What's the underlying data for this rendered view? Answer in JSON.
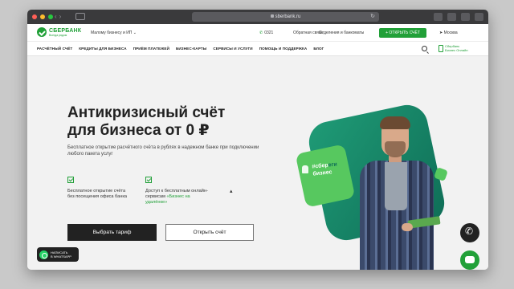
{
  "browser": {
    "address": "sberbank.ru"
  },
  "header": {
    "logo_name": "СБЕРБАНК",
    "logo_sub": "Всегда рядом",
    "segment": "Малому бизнесу и ИП ⌄",
    "phone": "0321",
    "feedback": "Обратная связь",
    "branches": "Отделения и банкоматы",
    "open_account": "+ ОТКРЫТЬ СЧЁТ",
    "city": "Москва"
  },
  "menu": {
    "items": [
      "РАСЧЁТНЫЙ СЧЁТ",
      "КРЕДИТЫ ДЛЯ БИЗНЕСА",
      "ПРИЁМ ПЛАТЕЖЕЙ",
      "БИЗНЕС-КАРТЫ",
      "СЕРВИСЫ И УСЛУГИ",
      "ПОМОЩЬ И ПОДДЕРЖКА",
      "БЛОГ"
    ],
    "business_online_1": "Сбербанк",
    "business_online_2": "Бизнес Онлайн"
  },
  "hero": {
    "title_line1": "Антикризисный счёт",
    "title_line2": "для бизнеса от 0 ₽",
    "lead": "Бесплатное открытие расчётного счёта в рублях в надежном банке при подключении любого пакета услуг",
    "feature1": "Бесплатное открытие счёта без посещения офиса банка",
    "feature2_text": "Доступ к бесплатным онлайн-сервисам",
    "feature2_link": "«Бизнес на удалёнке»",
    "btn_primary": "Выбрать тариф",
    "btn_secondary": "Открыть счёт",
    "badge_line1": "#сбер",
    "badge_line1_b": "еги",
    "badge_line2": "бизнес"
  },
  "widgets": {
    "whatsapp_line1": "НАПИСАТЬ",
    "whatsapp_line2": "В WHATSAPP"
  },
  "colors": {
    "brand_green": "#21a038",
    "dark": "#222222",
    "teal": "#1f9b76"
  }
}
